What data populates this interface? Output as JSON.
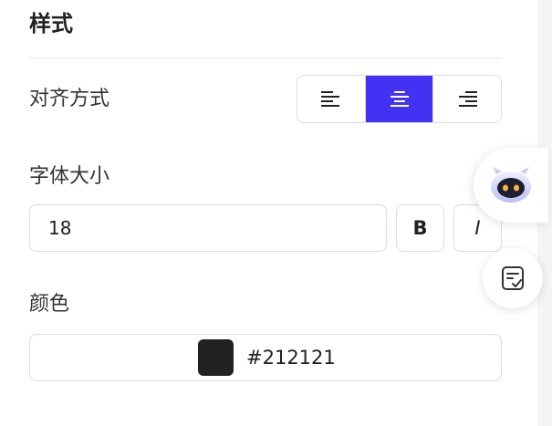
{
  "section": {
    "title": "样式"
  },
  "alignment": {
    "label": "对齐方式",
    "options": [
      {
        "name": "left",
        "icon": "align-left-icon",
        "active": false
      },
      {
        "name": "center",
        "icon": "align-center-icon",
        "active": true
      },
      {
        "name": "right",
        "icon": "align-right-icon",
        "active": false
      }
    ]
  },
  "font_size": {
    "label": "字体大小",
    "value": "18",
    "bold_label": "B",
    "italic_label": "I"
  },
  "color": {
    "label": "颜色",
    "value": "#212121",
    "swatch": "#212121"
  },
  "floating": {
    "assistant_icon": "robot-icon",
    "notes_icon": "checklist-icon"
  },
  "theme": {
    "accent": "#4332f3",
    "border": "#d9dce1",
    "text": "#212121"
  }
}
